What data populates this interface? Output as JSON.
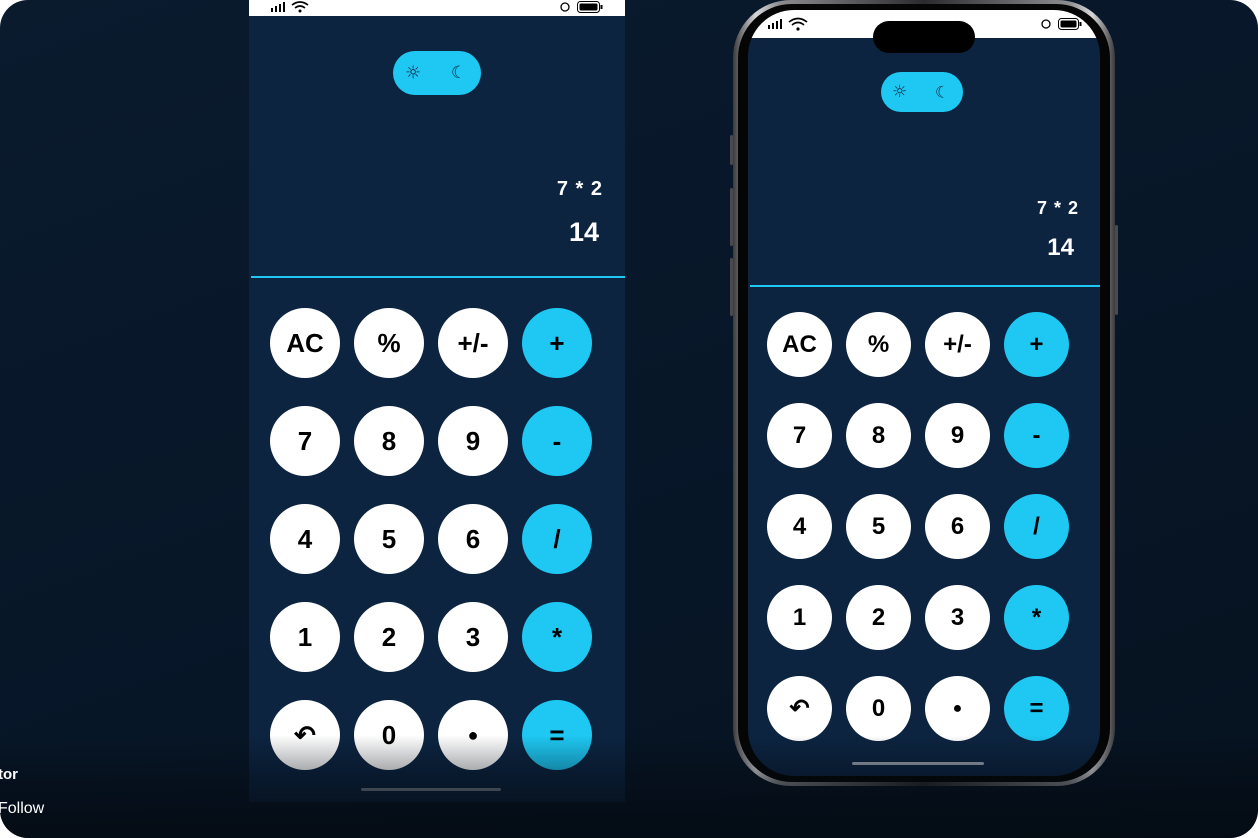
{
  "theme": {
    "accent": "#1ec8f3",
    "background": "#0c2440",
    "key_color": "#ffffff",
    "key_text": "#000000"
  },
  "toggle": {
    "light_icon": "sun-icon",
    "dark_icon": "moon-icon"
  },
  "display": {
    "expression": "7 * 2",
    "result": "14"
  },
  "keys": [
    {
      "label": "AC",
      "type": "function"
    },
    {
      "label": "%",
      "type": "function"
    },
    {
      "label": "+/-",
      "type": "function"
    },
    {
      "label": "+",
      "type": "operator"
    },
    {
      "label": "7",
      "type": "digit"
    },
    {
      "label": "8",
      "type": "digit"
    },
    {
      "label": "9",
      "type": "digit"
    },
    {
      "label": "-",
      "type": "operator"
    },
    {
      "label": "4",
      "type": "digit"
    },
    {
      "label": "5",
      "type": "digit"
    },
    {
      "label": "6",
      "type": "digit"
    },
    {
      "label": "/",
      "type": "operator"
    },
    {
      "label": "1",
      "type": "digit"
    },
    {
      "label": "2",
      "type": "digit"
    },
    {
      "label": "3",
      "type": "digit"
    },
    {
      "label": "*",
      "type": "operator"
    },
    {
      "label": "↶",
      "type": "function",
      "icon": "undo-icon"
    },
    {
      "label": "0",
      "type": "digit"
    },
    {
      "label": "●",
      "type": "digit",
      "icon": "decimal-point"
    },
    {
      "label": "=",
      "type": "operator"
    }
  ],
  "overlay": {
    "author": "tor",
    "follow": "Follow"
  }
}
